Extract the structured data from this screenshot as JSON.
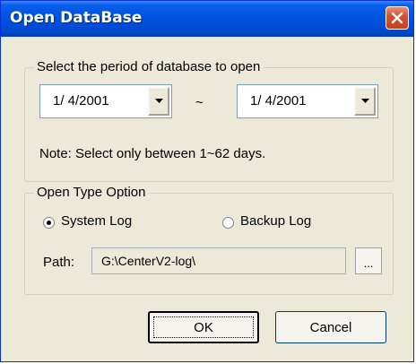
{
  "window": {
    "title": "Open DataBase",
    "title_bar_color": "#0054e3",
    "face_color": "#ece9d8"
  },
  "period_group": {
    "legend": "Select the period of database to open",
    "start_date": "1/  4/2001",
    "separator": "~",
    "end_date": "1/  4/2001",
    "note": "Note: Select only between 1~62 days."
  },
  "open_type_group": {
    "legend": "Open Type Option",
    "options": [
      {
        "label": "System Log",
        "selected": true
      },
      {
        "label": "Backup Log",
        "selected": false
      }
    ],
    "path_label": "Path:",
    "path_value": "G:\\CenterV2-log\\",
    "browse_label": "..."
  },
  "buttons": {
    "ok": "OK",
    "cancel": "Cancel"
  },
  "icons": {
    "close": "close-icon",
    "dropdown": "chevron-down-icon"
  }
}
